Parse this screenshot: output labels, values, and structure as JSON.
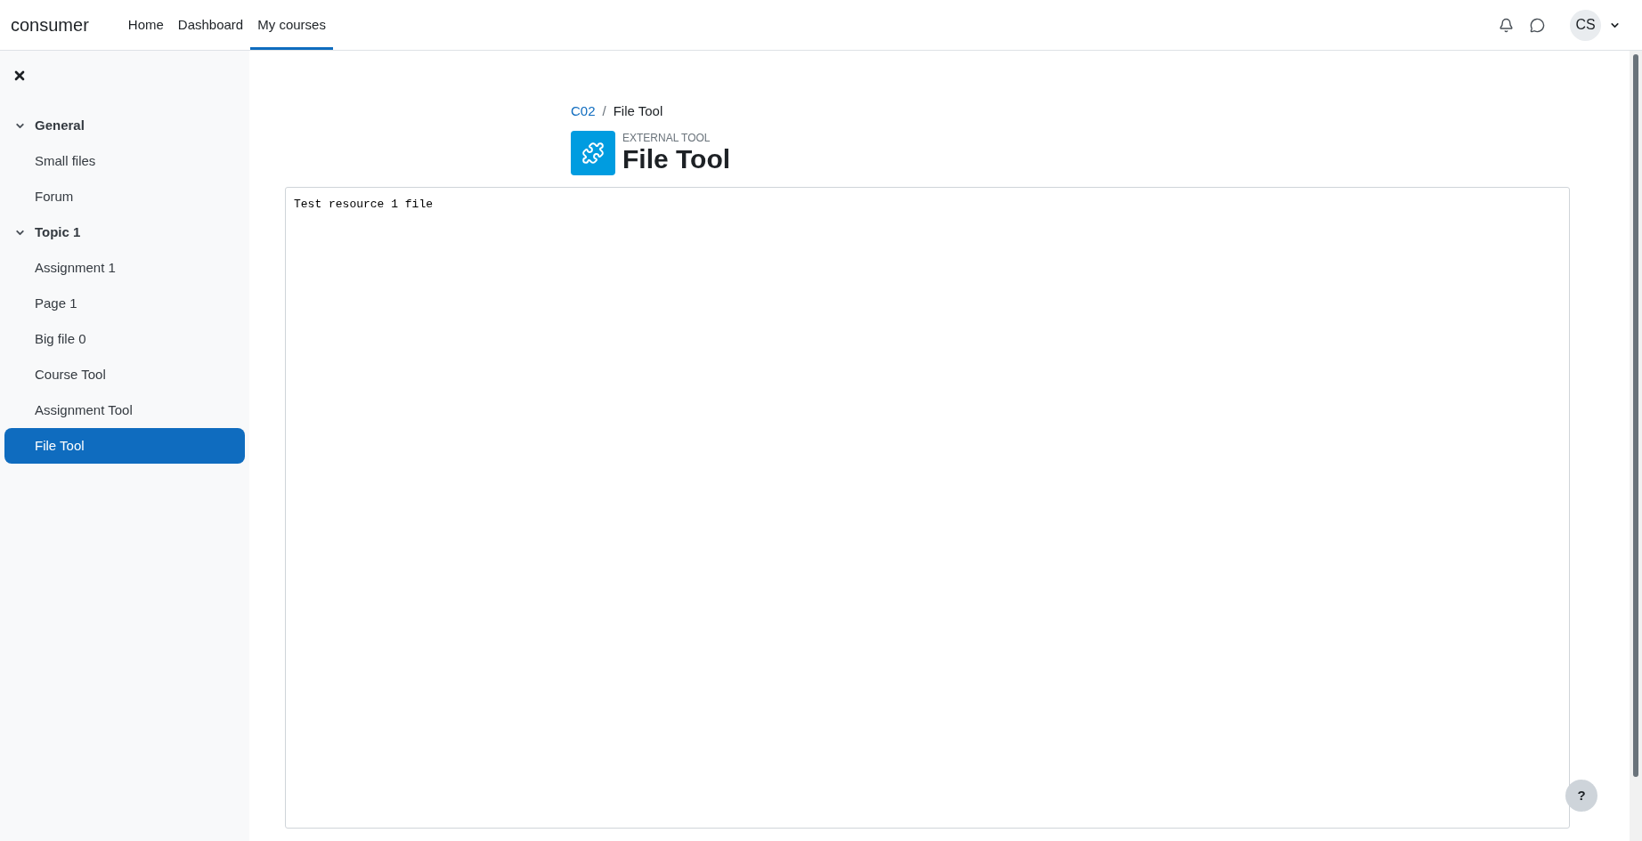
{
  "navbar": {
    "site_name": "consumer",
    "links": [
      {
        "label": "Home",
        "selected": false
      },
      {
        "label": "Dashboard",
        "selected": false
      },
      {
        "label": "My courses",
        "selected": true
      }
    ],
    "user_initials": "CS"
  },
  "sidebar": {
    "sections": [
      {
        "title": "General",
        "expanded": true,
        "children": [
          {
            "label": "Small files",
            "selected": false
          },
          {
            "label": "Forum",
            "selected": false
          }
        ]
      },
      {
        "title": "Topic 1",
        "expanded": true,
        "children": [
          {
            "label": "Assignment 1",
            "selected": false
          },
          {
            "label": "Page 1",
            "selected": false
          },
          {
            "label": "Big file 0",
            "selected": false
          },
          {
            "label": "Course Tool",
            "selected": false
          },
          {
            "label": "Assignment Tool",
            "selected": false
          },
          {
            "label": "File Tool",
            "selected": true
          }
        ]
      }
    ]
  },
  "breadcrumb_separator": "/",
  "breadcrumb": [
    {
      "label": "C02",
      "kind": "link"
    },
    {
      "label": "File Tool",
      "kind": "current"
    }
  ],
  "header": {
    "type_label": "EXTERNAL TOOL",
    "title": "File Tool"
  },
  "frame": {
    "content": "Test resource 1 file"
  },
  "help_button": {
    "label": "?"
  }
}
